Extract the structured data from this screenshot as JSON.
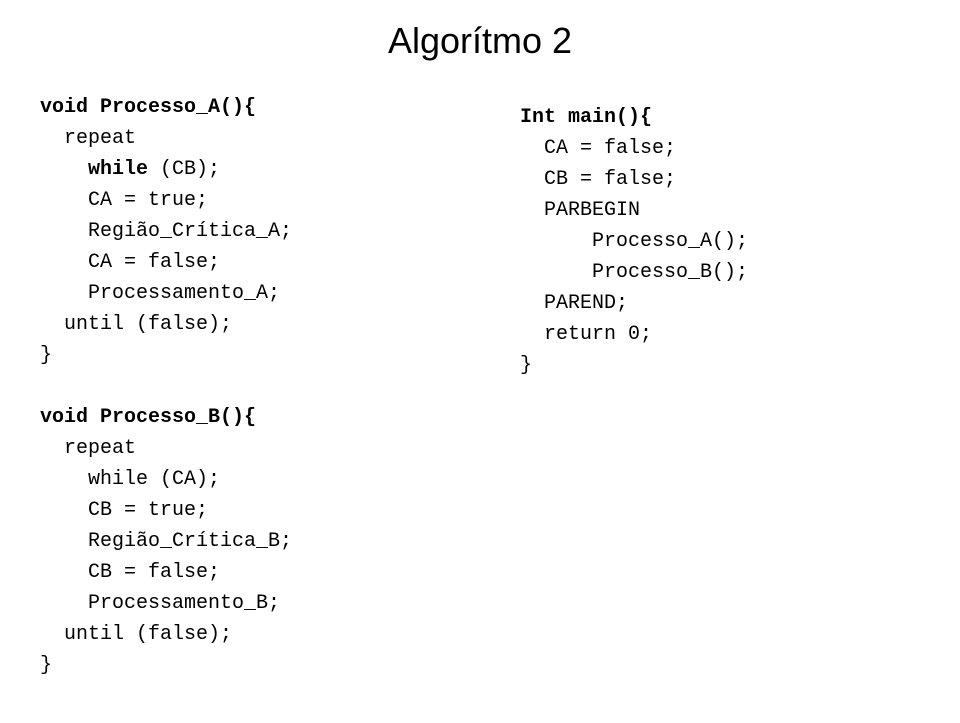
{
  "title": "Algorítmo 2",
  "left_column": {
    "processo_a": "void Processo_A(){\n  repeat\n    while (CB);\n    CA = true;\n    Região_Crítica_A;\n    CA = false;\n    Processamento_A;\n  until (false);\n}",
    "processo_b": "\nvoid Processo_B(){\n  repeat\n    while (CA);\n    CB = true;\n    Região_Crítica_B;\n    CB = false;\n    Processamento_B;\n  until (false);\n}"
  },
  "right_column": {
    "main": "Int main(){\n  CA = false;\n  CB = false;\n  PARBEGIN\n      Processo_A();\n      Processo_B();\n  PAREND;\n  return 0;\n}"
  }
}
